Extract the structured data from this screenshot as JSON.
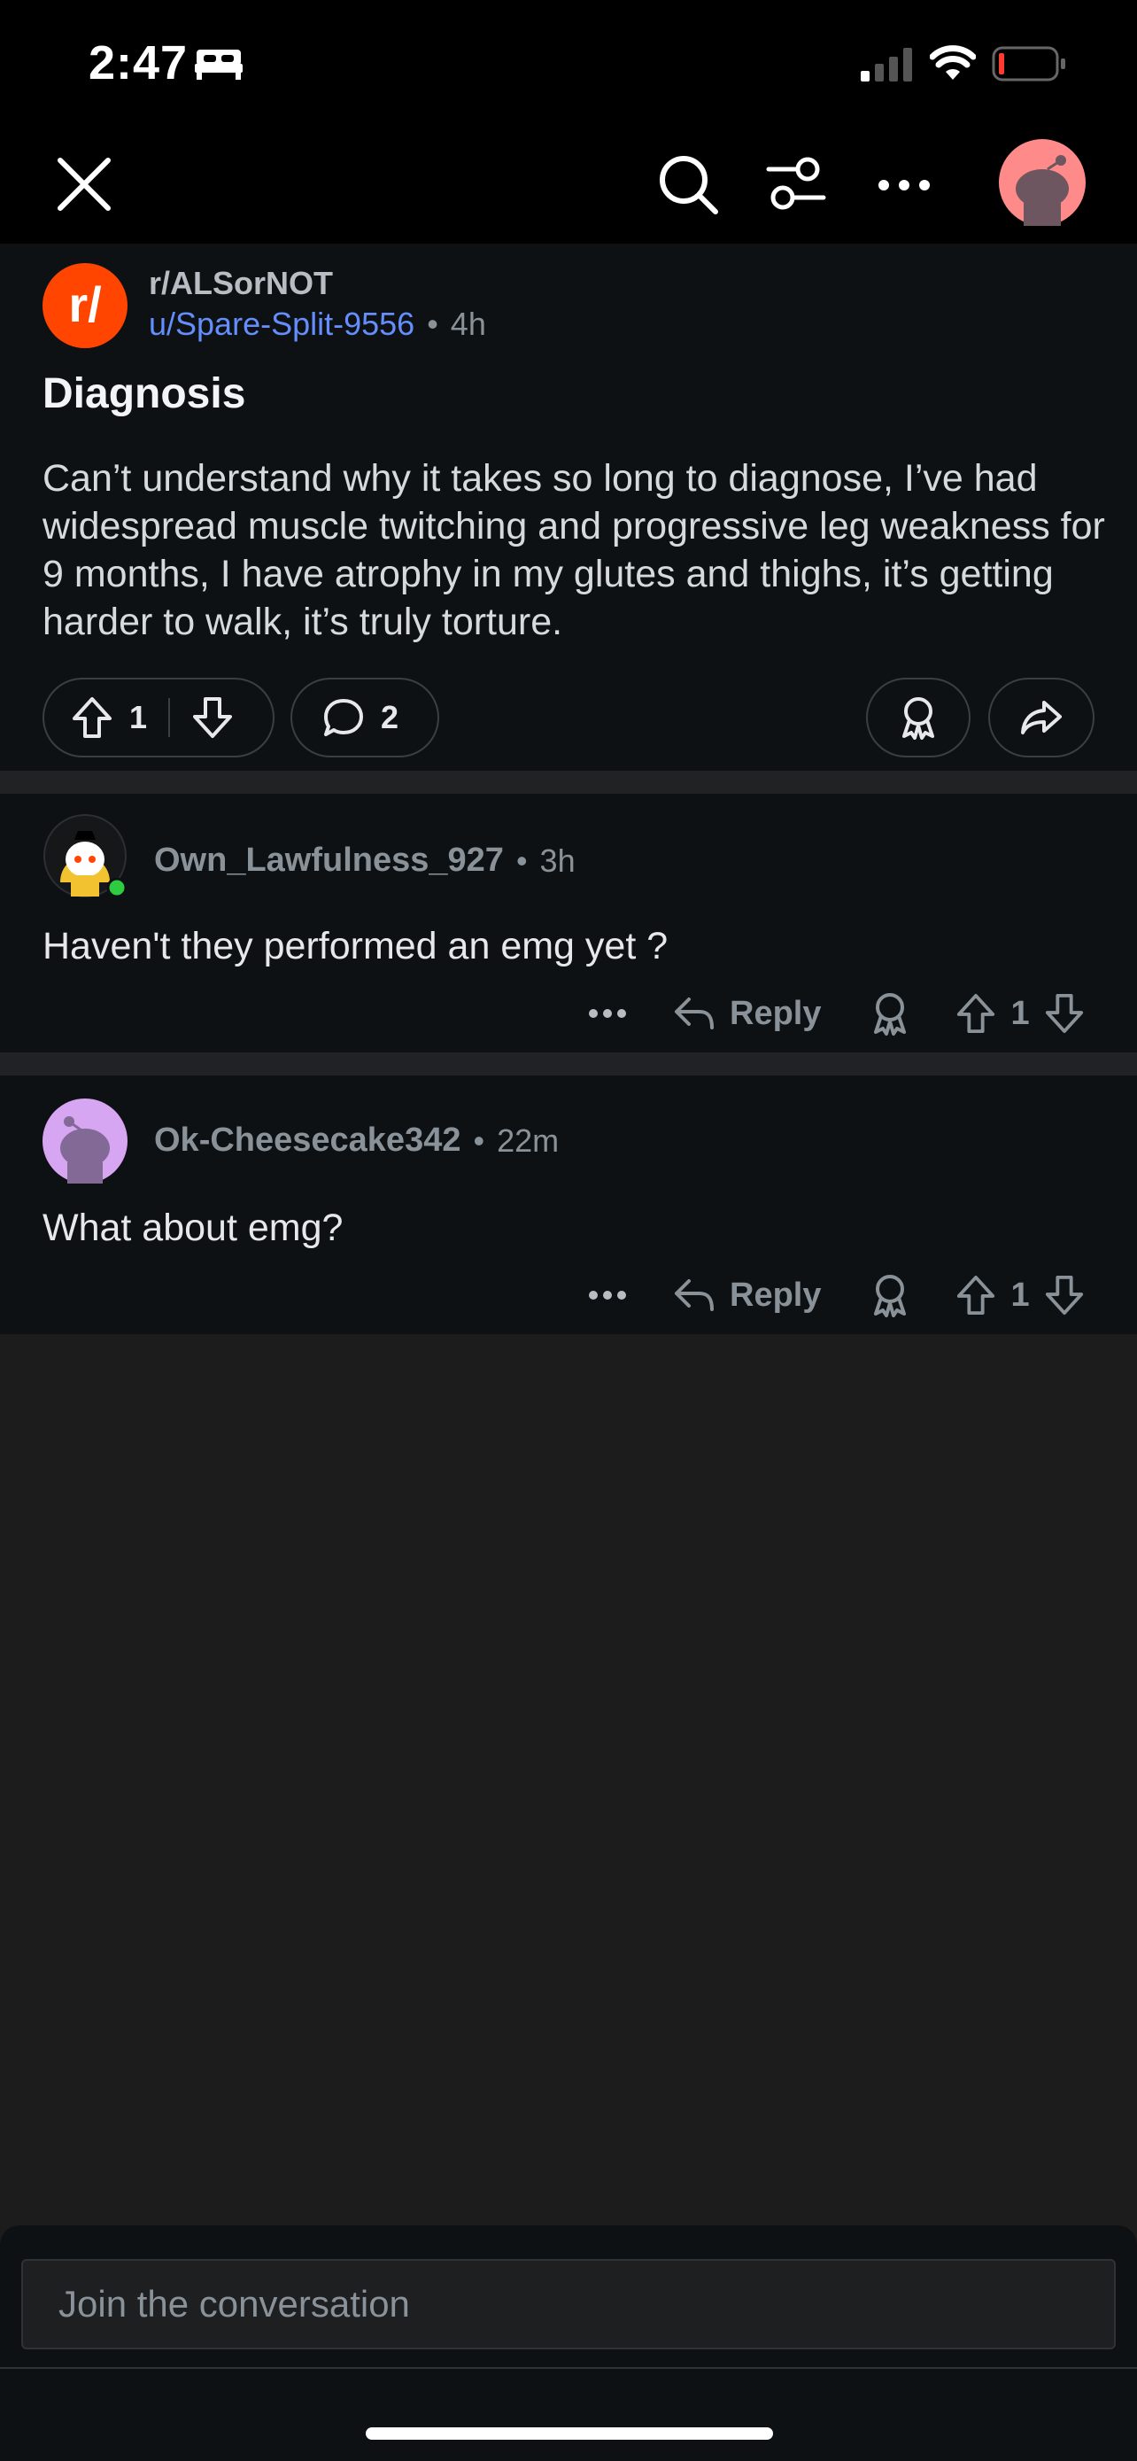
{
  "status_bar": {
    "time": "2:47"
  },
  "post": {
    "subreddit": "r/ALSorNOT",
    "author": "u/Spare-Split-9556",
    "age": "4h",
    "title": "Diagnosis",
    "body": "Can’t understand why it takes so long to diagnose, I’ve had widespread muscle twitching and progressive leg weakness for 9 months, I have atrophy in my glutes and thighs, it’s getting harder to walk, it’s truly torture.",
    "votes": "1",
    "comments": "2"
  },
  "comments": [
    {
      "username": "Own_Lawfulness_927",
      "age": "3h",
      "text": "Haven't they performed an emg yet ?",
      "reply_label": "Reply",
      "votes": "1"
    },
    {
      "username": "Ok-Cheesecake342",
      "age": "22m",
      "text": "What about emg?",
      "reply_label": "Reply",
      "votes": "1"
    }
  ],
  "composer": {
    "placeholder": "Join the conversation"
  },
  "colors": {
    "accent_orange": "#ff4500",
    "link_blue": "#648efc",
    "online_green": "#2ecc40"
  },
  "icons": [
    "close-icon",
    "search-icon",
    "filter-icon",
    "more-icon",
    "avatar",
    "upvote-icon",
    "downvote-icon",
    "comment-icon",
    "award-icon",
    "share-icon",
    "reply-icon"
  ]
}
